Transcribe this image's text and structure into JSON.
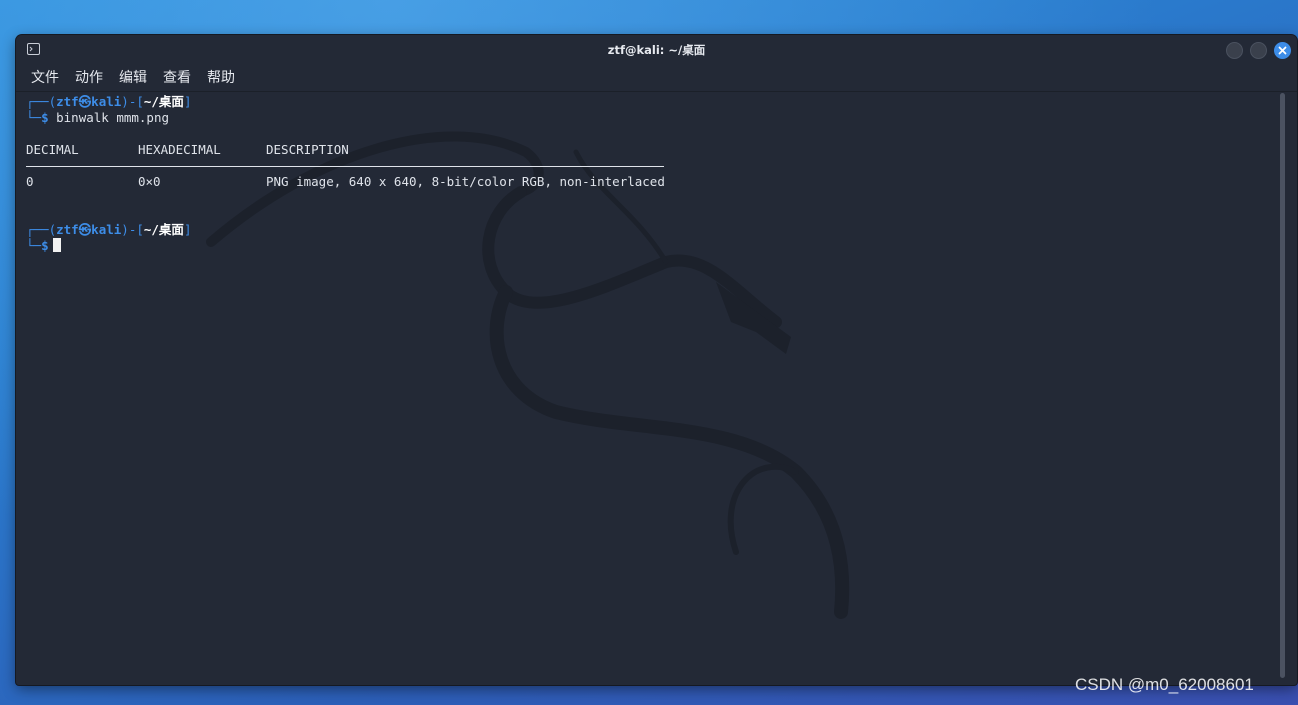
{
  "window": {
    "title": "ztf@kali: ~/桌面",
    "icon": "terminal-icon",
    "accent_color": "#3d8de8",
    "background_color": "#232936"
  },
  "menu": {
    "items": [
      "文件",
      "动作",
      "编辑",
      "查看",
      "帮助"
    ]
  },
  "terminal": {
    "prompt1": {
      "open": "┌──(",
      "userhost": "ztf㉿kali",
      "mid": ")-[",
      "path": "~/桌面",
      "close": "]",
      "second_prefix": "└─",
      "dollar": "$",
      "command": "binwalk mmm.png"
    },
    "table": {
      "headers": [
        "DECIMAL",
        "HEXADECIMAL",
        "DESCRIPTION"
      ],
      "rows": [
        [
          "0",
          "0×0",
          "PNG image, 640 x 640, 8-bit/color RGB, non-interlaced"
        ]
      ]
    },
    "prompt2": {
      "open": "┌──(",
      "userhost": "ztf㉿kali",
      "mid": ")-[",
      "path": "~/桌面",
      "close": "]",
      "second_prefix": "└─",
      "dollar": "$",
      "command": ""
    }
  },
  "watermark": "CSDN @m0_62008601"
}
